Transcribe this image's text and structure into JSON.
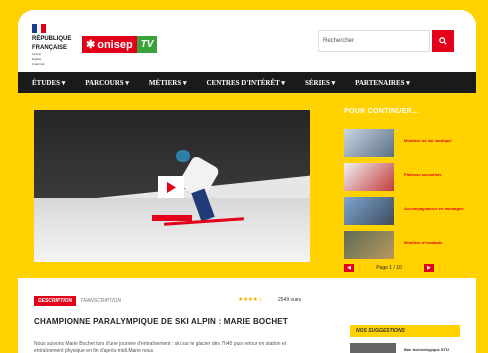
{
  "header": {
    "republique_lines": [
      "RÉPUBLIQUE",
      "FRANÇAISE"
    ],
    "motto": [
      "Liberté",
      "Égalité",
      "Fraternité"
    ],
    "logo_text": "onisep",
    "logo_tv": "TV",
    "search_placeholder": "Rechercher"
  },
  "nav": [
    "ÉTUDES ▾",
    "PARCOURS ▾",
    "MÉTIERS ▾",
    "CENTRES D'INTÉRÊT ▾",
    "SÉRIES ▾",
    "PARTENAIRES ▾"
  ],
  "sidebar": {
    "title": "POUR CONTINUER...",
    "items": [
      {
        "label": "Moniteur de ski nordique"
      },
      {
        "label": "Pisteuse secouriste"
      },
      {
        "label": "Accompagnatrice en montagne"
      },
      {
        "label": "Moniteur d'escalade"
      }
    ],
    "pager": "Page 1 / 10"
  },
  "video": {
    "tabs": [
      "DESCRIPTION",
      "TRANSCRIPTION"
    ],
    "stars": "★★★★☆",
    "views": "2549 vues",
    "title": "CHAMPIONNE PARALYMPIQUE DE SKI ALPIN : MARIE BOCHET",
    "description": "Nous suivons Marie Bochet lors d'une journée d'entraînement : ski sur le glacier dès 7h45 puis retour en station et entraînement physique en fin d'après-midi.Marie nous"
  },
  "suggestions": {
    "title": "NOS SUGGESTIONS",
    "items": [
      {
        "label": "Bac technologique STI2"
      }
    ]
  },
  "colors": {
    "accent": "#e2001a",
    "brand_yellow": "#ffd200",
    "tv_green": "#3aa23a"
  }
}
